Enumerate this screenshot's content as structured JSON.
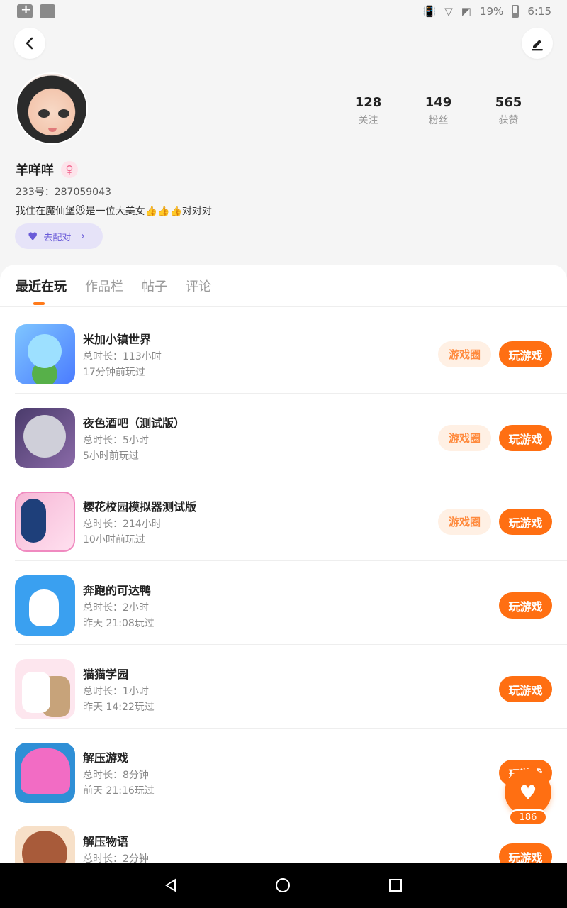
{
  "status": {
    "battery": "19%",
    "time": "6:15"
  },
  "profile": {
    "username": "羊咩咩",
    "gender_icon": "♀",
    "uid": "233号：287059043",
    "bio": "我住在魔仙堡🐭是一位大美女👍👍👍对对对",
    "match_label": "去配对",
    "stats": [
      {
        "num": "128",
        "label": "关注"
      },
      {
        "num": "149",
        "label": "粉丝"
      },
      {
        "num": "565",
        "label": "获赞"
      }
    ]
  },
  "tabs": [
    "最近在玩",
    "作品栏",
    "帖子",
    "评论"
  ],
  "game_circle_label": "游戏圈",
  "play_label": "玩游戏",
  "games": [
    {
      "title": "米加小镇世界",
      "duration": "总时长：113小时",
      "last": "17分钟前玩过",
      "has_circle": true
    },
    {
      "title": "夜色酒吧（测试版）",
      "duration": "总时长：5小时",
      "last": "5小时前玩过",
      "has_circle": true
    },
    {
      "title": "樱花校园模拟器测试版",
      "duration": "总时长：214小时",
      "last": "10小时前玩过",
      "has_circle": true
    },
    {
      "title": "奔跑的可达鸭",
      "duration": "总时长：2小时",
      "last": "昨天 21:08玩过",
      "has_circle": false
    },
    {
      "title": "猫猫学园",
      "duration": "总时长：1小时",
      "last": "昨天 14:22玩过",
      "has_circle": false
    },
    {
      "title": "解压游戏",
      "duration": "总时长：8分钟",
      "last": "前天 21:16玩过",
      "has_circle": false
    },
    {
      "title": "解压物语",
      "duration": "总时长：2分钟",
      "last": "",
      "has_circle": false
    }
  ],
  "fab_count": "186"
}
